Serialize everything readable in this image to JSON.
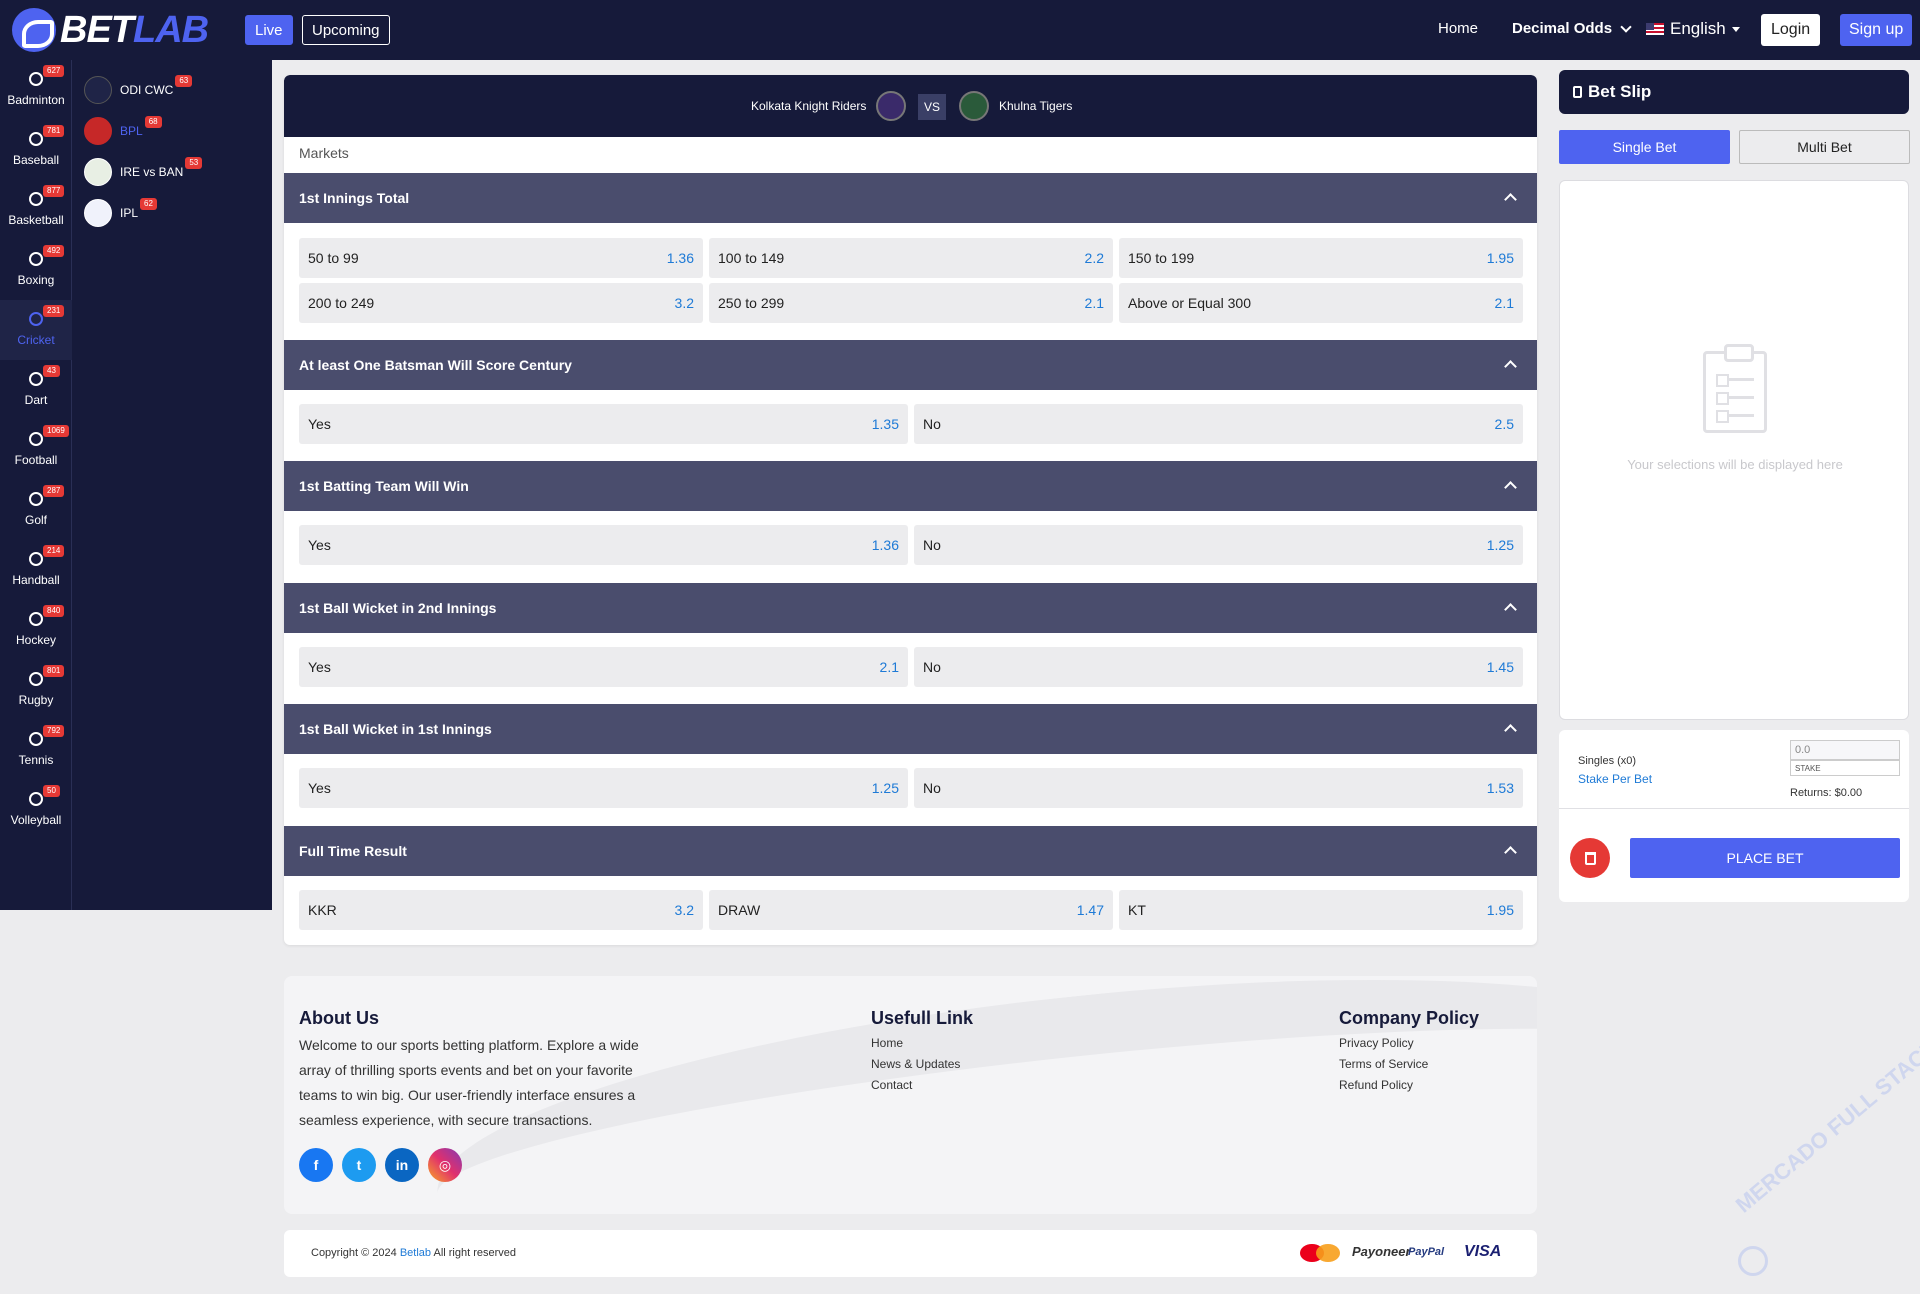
{
  "brand": {
    "logo_left": "BET",
    "logo_right": "LAB"
  },
  "topnav": {
    "live_label": "Live",
    "upcoming_label": "Upcoming",
    "home_label": "Home",
    "odds_label": "Decimal Odds",
    "language_label": "English",
    "login_label": "Login",
    "signup_label": "Sign up"
  },
  "sports": [
    {
      "label": "Badminton",
      "count": "627"
    },
    {
      "label": "Baseball",
      "count": "781"
    },
    {
      "label": "Basketball",
      "count": "877"
    },
    {
      "label": "Boxing",
      "count": "492"
    },
    {
      "label": "Cricket",
      "count": "231"
    },
    {
      "label": "Dart",
      "count": "43"
    },
    {
      "label": "Football",
      "count": "1069"
    },
    {
      "label": "Golf",
      "count": "287"
    },
    {
      "label": "Handball",
      "count": "214"
    },
    {
      "label": "Hockey",
      "count": "840"
    },
    {
      "label": "Rugby",
      "count": "801"
    },
    {
      "label": "Tennis",
      "count": "792"
    },
    {
      "label": "Volleyball",
      "count": "50"
    }
  ],
  "leagues": [
    {
      "label": "ODI CWC",
      "count": "63"
    },
    {
      "label": "BPL",
      "count": "68"
    },
    {
      "label": "IRE vs BAN",
      "count": "53"
    },
    {
      "label": "IPL",
      "count": "62"
    }
  ],
  "match": {
    "home": "Kolkata Knight Riders",
    "vs": "VS",
    "away": "Khulna Tigers"
  },
  "markets_label": "Markets",
  "markets": [
    {
      "title": "1st Innings Total",
      "options": [
        {
          "label": "50 to 99",
          "odds": "1.36"
        },
        {
          "label": "100 to 149",
          "odds": "2.2"
        },
        {
          "label": "150 to 199",
          "odds": "1.95"
        },
        {
          "label": "200 to 249",
          "odds": "3.2"
        },
        {
          "label": "250 to 299",
          "odds": "2.1"
        },
        {
          "label": "Above or Equal 300",
          "odds": "2.1"
        }
      ]
    },
    {
      "title": "At least One Batsman Will Score Century",
      "options": [
        {
          "label": "Yes",
          "odds": "1.35"
        },
        {
          "label": "No",
          "odds": "2.5"
        }
      ]
    },
    {
      "title": "1st Batting Team Will Win",
      "options": [
        {
          "label": "Yes",
          "odds": "1.36"
        },
        {
          "label": "No",
          "odds": "1.25"
        }
      ]
    },
    {
      "title": "1st Ball Wicket in 2nd Innings",
      "options": [
        {
          "label": "Yes",
          "odds": "2.1"
        },
        {
          "label": "No",
          "odds": "1.45"
        }
      ]
    },
    {
      "title": "1st Ball Wicket in 1st Innings",
      "options": [
        {
          "label": "Yes",
          "odds": "1.25"
        },
        {
          "label": "No",
          "odds": "1.53"
        }
      ]
    },
    {
      "title": "Full Time Result",
      "options": [
        {
          "label": "KKR",
          "odds": "3.2"
        },
        {
          "label": "DRAW",
          "odds": "1.47"
        },
        {
          "label": "KT",
          "odds": "1.95"
        }
      ]
    }
  ],
  "footer": {
    "about_title": "About Us",
    "about_text": "Welcome to our sports betting platform. Explore a wide array of thrilling sports events and bet on your favorite teams to win big. Our user-friendly interface ensures a seamless experience, with secure transactions.",
    "links_title": "Usefull Link",
    "links": [
      "Home",
      "News & Updates",
      "Contact"
    ],
    "policy_title": "Company Policy",
    "policies": [
      "Privacy Policy",
      "Terms of Service",
      "Refund Policy"
    ],
    "social": {
      "facebook": "f",
      "twitter": "t",
      "linkedin": "in",
      "instagram": "◎"
    },
    "copyright_prefix": "Copyright © 2024 ",
    "copyright_brand": "Betlab",
    "copyright_suffix": " All right reserved",
    "payments": {
      "payoneer": "Payoneer",
      "paypal": "PayPal",
      "visa": "VISA"
    }
  },
  "betslip": {
    "title": "Bet Slip",
    "tab_single": "Single Bet",
    "tab_multi": "Multi Bet",
    "empty_text": "Your selections will be displayed here",
    "singles_label": "Singles (x0)",
    "stake_per_bet": "Stake Per Bet",
    "stake_value": "0.0",
    "stake_label": "STAKE",
    "returns": "Returns: $0.00",
    "place_bet": "PLACE BET"
  },
  "watermark": "MERCADO FULL STACK",
  "colors": {
    "navy": "#161a3a",
    "accent": "#4e63f0",
    "market_header": "#4a4d6d",
    "odds": "#1e7ad6",
    "danger": "#e53935"
  }
}
